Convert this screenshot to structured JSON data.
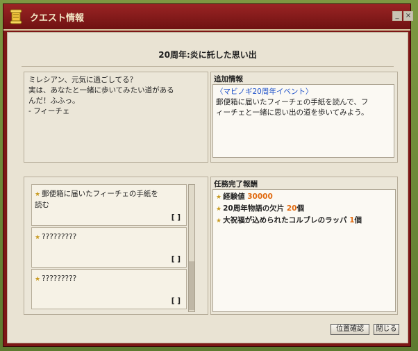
{
  "window": {
    "title": "クエスト情報",
    "minimize": "_",
    "close": "×"
  },
  "quest": {
    "title": "20周年:炎に託した思い出"
  },
  "message": {
    "lines": [
      "ミレシアン、元気に過ごしてる？",
      "実は、あなたと一緒に歩いてみたい道がある",
      "んだ！ふふっ。",
      "- フィーチェ"
    ]
  },
  "additional": {
    "header": "追加情報",
    "event_link": "〈マビノギ20周年イベント〉",
    "lines": [
      "郵便箱に届いたフィーチェの手紙を読んで、フ",
      "ィーチェと一緒に思い出の道を歩いてみよう。"
    ]
  },
  "tasks": [
    {
      "lines": [
        "郵便箱に届いたフィーチェの手紙を",
        "読む"
      ],
      "status": "[ ]"
    },
    {
      "lines": [
        "?????????"
      ],
      "status": "[ ]"
    },
    {
      "lines": [
        "?????????"
      ],
      "status": "[ ]"
    }
  ],
  "rewards": {
    "header": "任務完了報酬",
    "items": [
      {
        "label": "経験値",
        "value": "30000",
        "suffix": ""
      },
      {
        "label": "20周年物語の欠片",
        "value": "20",
        "suffix": "個"
      },
      {
        "label": "大祝福が込められたコルブレのラッパ",
        "value": "1",
        "suffix": "個"
      }
    ]
  },
  "buttons": {
    "locate": "位置確認",
    "close": "閉じる"
  },
  "icons": {
    "title": "scroll-icon",
    "task": "star-icon"
  },
  "colors": {
    "titlebar": "#8a1c1c",
    "link": "#1a4ec9",
    "highlight": "#e06a10"
  }
}
